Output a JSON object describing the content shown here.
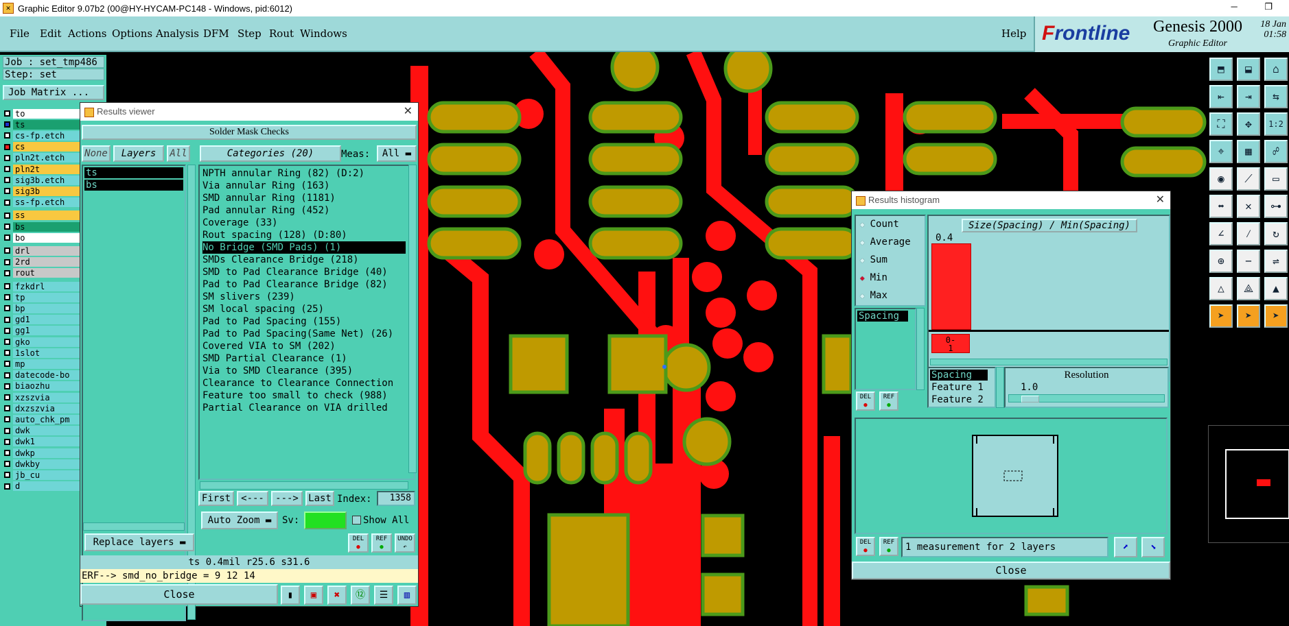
{
  "window": {
    "title": "Graphic Editor 9.07b2 (00@HY-HYCAM-PC148 - Windows, pid:6012)",
    "controls": "─ ❐"
  },
  "menu": [
    "File",
    "Edit",
    "Actions",
    "Options",
    "Analysis",
    "DFM",
    "Step",
    "Rout",
    "Windows"
  ],
  "help": "Help",
  "logo": {
    "brand_f": "F",
    "brand_rest": "rontline",
    "product": "Genesis 2000",
    "sub": "Graphic Editor",
    "date": "18 Jan",
    "time": "01:58"
  },
  "job": {
    "job_line": "Job : set_tmp486",
    "step_line": "Step: set",
    "matrix_button": "Job Matrix ..."
  },
  "layers": [
    {
      "name": "to",
      "style": "white",
      "cb": "off"
    },
    {
      "name": "ts",
      "style": "green",
      "cb": "on"
    },
    {
      "name": "cs-fp.etch",
      "style": "teal",
      "cb": "off"
    },
    {
      "name": "cs",
      "style": "yellow",
      "cb": "red"
    },
    {
      "name": "pln2t.etch",
      "style": "teal",
      "cb": "off"
    },
    {
      "name": "pln2t",
      "style": "yellow",
      "cb": "off"
    },
    {
      "name": "sig3b.etch",
      "style": "teal",
      "cb": "off"
    },
    {
      "name": "sig3b",
      "style": "yellow",
      "cb": "off"
    },
    {
      "name": "ss-fp.etch",
      "style": "teal",
      "cb": "off"
    },
    {
      "name": "ss",
      "style": "yellow",
      "cb": "off"
    },
    {
      "name": "bs",
      "style": "green",
      "cb": "off"
    },
    {
      "name": "bo",
      "style": "white",
      "cb": "off"
    },
    {
      "name": "drl",
      "style": "gray",
      "cb": "off"
    },
    {
      "name": "2rd",
      "style": "gray",
      "cb": "off"
    },
    {
      "name": "rout",
      "style": "gray",
      "cb": "off"
    },
    {
      "name": "fzkdrl",
      "style": "teal",
      "cb": "off"
    },
    {
      "name": "tp",
      "style": "teal",
      "cb": "off"
    },
    {
      "name": "bp",
      "style": "teal",
      "cb": "off"
    },
    {
      "name": "gd1",
      "style": "teal",
      "cb": "off"
    },
    {
      "name": "gg1",
      "style": "teal",
      "cb": "off"
    },
    {
      "name": "gko",
      "style": "teal",
      "cb": "off"
    },
    {
      "name": "1slot",
      "style": "teal",
      "cb": "off"
    },
    {
      "name": "mp",
      "style": "teal",
      "cb": "off"
    },
    {
      "name": "datecode-bo",
      "style": "teal",
      "cb": "off"
    },
    {
      "name": "biaozhu",
      "style": "teal",
      "cb": "off"
    },
    {
      "name": "xzszvia",
      "style": "teal",
      "cb": "off"
    },
    {
      "name": "dxzszvia",
      "style": "teal",
      "cb": "off"
    },
    {
      "name": "auto_chk_pm",
      "style": "teal",
      "cb": "off"
    },
    {
      "name": "dwk",
      "style": "teal",
      "cb": "off"
    },
    {
      "name": "dwk1",
      "style": "teal",
      "cb": "off"
    },
    {
      "name": "dwkp",
      "style": "teal",
      "cb": "off"
    },
    {
      "name": "dwkby",
      "style": "teal",
      "cb": "off"
    },
    {
      "name": "jb_cu",
      "style": "teal",
      "cb": "off"
    },
    {
      "name": "d",
      "style": "teal",
      "cb": "off"
    }
  ],
  "results_viewer": {
    "title": "Results viewer",
    "header": "Solder Mask Checks",
    "none": "None",
    "layers": "Layers",
    "all": "All",
    "categories_label": "Categories (20)",
    "meas_label": "Meas:",
    "meas_value": "All",
    "selected_layers": [
      "ts",
      "bs"
    ],
    "categories": [
      {
        "text": "NPTH annular Ring (82)      (D:2)"
      },
      {
        "text": "Via annular Ring (163)"
      },
      {
        "text": "SMD annular Ring (1181)"
      },
      {
        "text": "Pad annular Ring (452)"
      },
      {
        "text": "Coverage (33)"
      },
      {
        "text": "Rout spacing (128)         (D:80)"
      },
      {
        "text": "No Bridge (SMD Pads) (1)",
        "selected": true
      },
      {
        "text": "SMDs Clearance Bridge (218)"
      },
      {
        "text": "SMD to Pad Clearance Bridge (40)"
      },
      {
        "text": "Pad to Pad Clearance Bridge (82)"
      },
      {
        "text": "SM slivers (239)"
      },
      {
        "text": "SM local spacing (25)"
      },
      {
        "text": "Pad to Pad Spacing (155)"
      },
      {
        "text": "Pad to Pad Spacing(Same Net) (26)"
      },
      {
        "text": "Covered VIA to SM (202)"
      },
      {
        "text": "SMD Partial Clearance (1)"
      },
      {
        "text": "Via to SMD Clearance (395)"
      },
      {
        "text": "Clearance to Clearance Connection"
      },
      {
        "text": "Feature too small to check (988)"
      },
      {
        "text": "Partial Clearance on VIA drilled"
      }
    ],
    "nav": {
      "first": "First",
      "prev": "<---",
      "next": "--->",
      "last": "Last",
      "index_label": "Index:",
      "index_value": "1358"
    },
    "auto_zoom": "Auto Zoom",
    "sv_label": "Sv:",
    "show_all": "Show All",
    "replace_layers": "Replace layers",
    "del": "DEL",
    "ref": "REF",
    "undo": "UNDO",
    "status": "ts 0.4mil  r25.6  s31.6",
    "erf": "ERF--> smd_no_bridge = 9 12 14",
    "close": "Close"
  },
  "histogram": {
    "title": "Results histogram",
    "options": [
      {
        "label": "Count",
        "checked": false
      },
      {
        "label": "Average",
        "checked": false
      },
      {
        "label": "Sum",
        "checked": false
      },
      {
        "label": "Min",
        "checked": true
      },
      {
        "label": "Max",
        "checked": false
      }
    ],
    "list_item": "Spacing",
    "del": "DEL",
    "ref": "REF",
    "chart_header": "Size(Spacing) / Min(Spacing)",
    "bar_value": "0.4",
    "bin_label_1": "0-",
    "bin_label_2": "1",
    "fields": [
      "Spacing",
      "Feature 1",
      "Feature 2"
    ],
    "resolution_label": "Resolution",
    "resolution_value": "1.0",
    "message": "1 measurement for 2 layers",
    "close": "Close"
  },
  "toolbar_icons": [
    "open-icon",
    "save-icon",
    "home-icon",
    "snap-left-icon",
    "snap-right-icon",
    "snap-both-icon",
    "fit-icon",
    "center-icon",
    "ratio-icon",
    "measure-icon",
    "grid-icon",
    "net-icon",
    "record-icon",
    "shape-icon",
    "ruler-icon",
    "connect-icon",
    "cross-icon",
    "node-icon",
    "line-icon",
    "slash-icon",
    "arc-icon",
    "add-point-icon",
    "minus-icon",
    "flip-icon",
    "triangle-icon",
    "triangle2-icon",
    "triangle3-icon",
    "pointer-icon",
    "pointer2-icon",
    "pointer3-icon"
  ],
  "toolbar_glyphs": [
    "⬒",
    "⬓",
    "⌂",
    "⇤",
    "⇥",
    "⇆",
    "⛶",
    "✥",
    "1:2",
    "⌖",
    "▦",
    "☍",
    "◉",
    "⟋",
    "▭",
    "⬌",
    "✕",
    "⊶",
    "∠",
    "⁄",
    "↻",
    "⊕",
    "−",
    "⇌",
    "△",
    "⟁",
    "▲",
    "➤",
    "➤",
    "➤"
  ]
}
